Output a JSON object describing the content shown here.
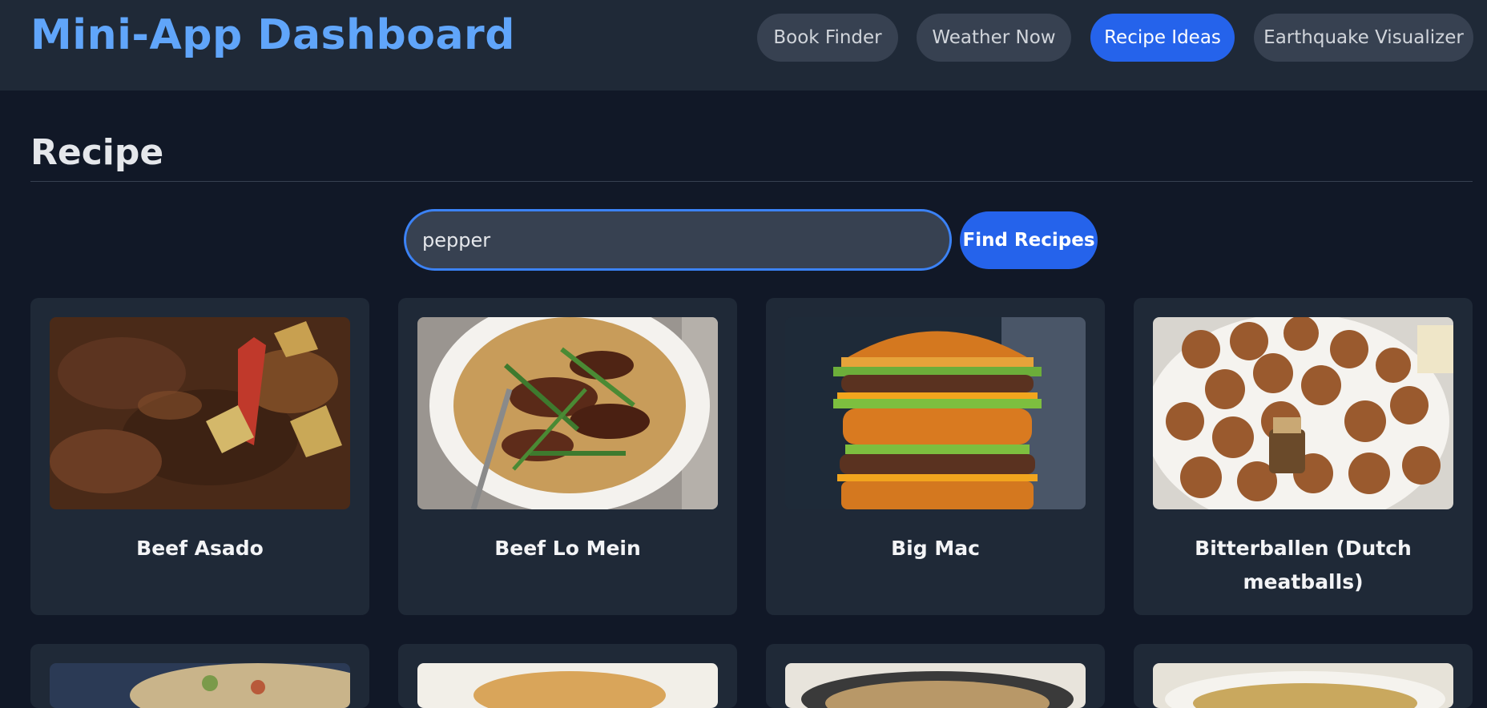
{
  "header": {
    "app_title": "Mini-App Dashboard",
    "nav": [
      {
        "label": "Book Finder",
        "active": false
      },
      {
        "label": "Weather Now",
        "active": false
      },
      {
        "label": "Recipe Ideas",
        "active": true
      },
      {
        "label": "Earthquake Visualizer",
        "active": false
      }
    ]
  },
  "main": {
    "section_title": "Recipe",
    "search": {
      "value": "pepper",
      "button_label": "Find Recipes"
    },
    "recipes": [
      {
        "title": "Beef Asado"
      },
      {
        "title": "Beef Lo Mein"
      },
      {
        "title": "Big Mac"
      },
      {
        "title": "Bitterballen (Dutch meatballs)"
      }
    ]
  },
  "colors": {
    "background": "#111827",
    "header": "#1f2937",
    "accent": "#2563eb",
    "title_blue": "#60a5fa",
    "card": "#1f2937"
  }
}
